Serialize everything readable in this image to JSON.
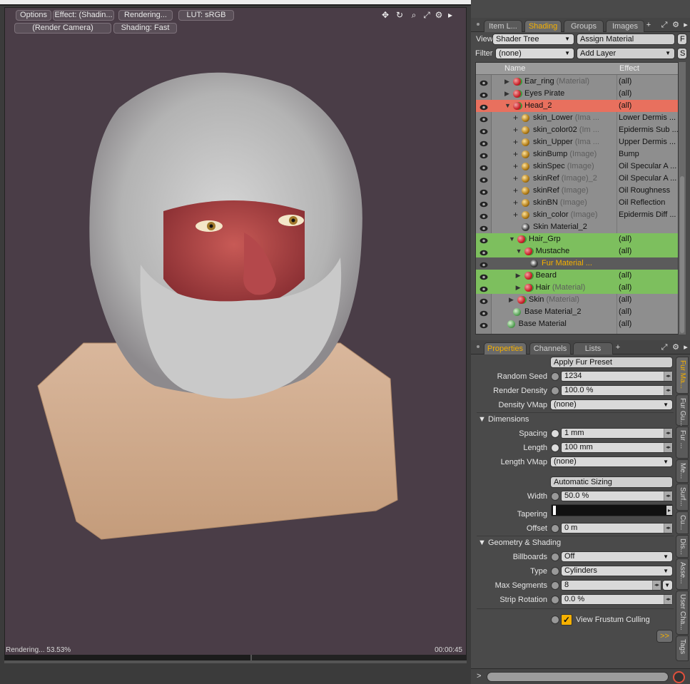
{
  "viewport": {
    "toolbar": {
      "options": "Options",
      "effect": "Effect: (Shadin...",
      "rendering": "Rendering...",
      "lut": "LUT: sRGB",
      "camera": "(Render Camera)",
      "shading": "Shading: Fast"
    },
    "status_left": "Rendering... 53.53%",
    "status_right": "00:00:45",
    "progress": 0.5353
  },
  "shading_panel": {
    "tabs": [
      "Item L...",
      "Shading",
      "Groups",
      "Images"
    ],
    "active_tab": "Shading",
    "add_tab": "+",
    "view_label": "View",
    "view_value": "Shader Tree",
    "assign_material": "Assign Material",
    "f_button": "F",
    "filter_label": "Filter",
    "filter_value": "(none)",
    "add_layer": "Add Layer",
    "s_button": "S",
    "columns": {
      "name": "Name",
      "effect": "Effect"
    },
    "rows": [
      {
        "name": "Ear_ring",
        "type": "(Material)",
        "effect": "(all)",
        "indent": 1,
        "expander": "arrow-right",
        "ball": "red"
      },
      {
        "name": "Eyes Pirate",
        "type": "",
        "effect": "(all)",
        "indent": 1,
        "expander": "arrow-right",
        "ball": "red"
      },
      {
        "name": "Head_2",
        "type": "",
        "effect": "(all)",
        "indent": 1,
        "expander": "arrow-down",
        "ball": "red",
        "highlight": "red"
      },
      {
        "name": "skin_Lower",
        "type": "(Ima ...",
        "effect": "Lower Dermis ...",
        "indent": 2,
        "expander": "plus",
        "ball": "image"
      },
      {
        "name": "skin_color02",
        "type": "(Im ...",
        "effect": "Epidermis Sub ...",
        "indent": 2,
        "expander": "plus",
        "ball": "image"
      },
      {
        "name": "skin_Upper",
        "type": "(Ima ...",
        "effect": "Upper Dermis ...",
        "indent": 2,
        "expander": "plus",
        "ball": "image"
      },
      {
        "name": "skinBump",
        "type": "(Image)",
        "effect": "Bump",
        "indent": 2,
        "expander": "plus",
        "ball": "image"
      },
      {
        "name": "skinSpec",
        "type": "(Image)",
        "effect": "Oil Specular A ...",
        "indent": 2,
        "expander": "plus",
        "ball": "image"
      },
      {
        "name": "skinRef",
        "type": "(Image)_2",
        "effect": "Oil Specular A ...",
        "indent": 2,
        "expander": "plus",
        "ball": "image"
      },
      {
        "name": "skinRef",
        "type": "(Image)",
        "effect": "Oil Roughness",
        "indent": 2,
        "expander": "plus",
        "ball": "image"
      },
      {
        "name": "skinBN",
        "type": "(Image)",
        "effect": "Oil Reflection",
        "indent": 2,
        "expander": "plus",
        "ball": "image"
      },
      {
        "name": "skin_color",
        "type": "(Image)",
        "effect": "Epidermis Diff ...",
        "indent": 2,
        "expander": "plus",
        "ball": "image"
      },
      {
        "name": "Skin Material_2",
        "type": "",
        "effect": "",
        "indent": 2,
        "expander": "none",
        "ball": "fur"
      },
      {
        "name": "Hair_Grp",
        "type": "",
        "effect": "(all)",
        "indent": 1.5,
        "expander": "arrow-down",
        "ball": "red",
        "highlight": "green"
      },
      {
        "name": "Mustache",
        "type": "",
        "effect": "(all)",
        "indent": 2.3,
        "expander": "arrow-down",
        "ball": "red",
        "highlight": "green"
      },
      {
        "name": "Fur Material ...",
        "type": "",
        "effect": "",
        "indent": 3,
        "expander": "none",
        "ball": "fur",
        "highlight": "selected"
      },
      {
        "name": "Beard",
        "type": "",
        "effect": "(all)",
        "indent": 2.3,
        "expander": "arrow-right",
        "ball": "red",
        "highlight": "green"
      },
      {
        "name": "Hair",
        "type": "(Material)",
        "effect": "(all)",
        "indent": 2.3,
        "expander": "arrow-right",
        "ball": "red",
        "highlight": "green"
      },
      {
        "name": "Skin",
        "type": "(Material)",
        "effect": "(all)",
        "indent": 1.5,
        "expander": "arrow-right",
        "ball": "red"
      },
      {
        "name": "Base Material_2",
        "type": "",
        "effect": "(all)",
        "indent": 1,
        "expander": "none",
        "ball": "green"
      },
      {
        "name": "Base Material",
        "type": "",
        "effect": "(all)",
        "indent": 0.3,
        "expander": "none",
        "ball": "green"
      }
    ]
  },
  "properties_panel": {
    "tabs": [
      "Properties",
      "Channels",
      "Lists"
    ],
    "active_tab": "Properties",
    "add_tab": "+",
    "apply_preset": "Apply Fur Preset",
    "random_seed": {
      "label": "Random Seed",
      "value": "1234"
    },
    "render_density": {
      "label": "Render Density",
      "value": "100.0 %"
    },
    "density_vmap": {
      "label": "Density VMap",
      "value": "(none)"
    },
    "dimensions_header": "Dimensions",
    "spacing": {
      "label": "Spacing",
      "value": "1 mm"
    },
    "length": {
      "label": "Length",
      "value": "100 mm"
    },
    "length_vmap": {
      "label": "Length VMap",
      "value": "(none)"
    },
    "auto_sizing": "Automatic Sizing",
    "width": {
      "label": "Width",
      "value": "50.0 %"
    },
    "tapering": {
      "label": "Tapering"
    },
    "offset": {
      "label": "Offset",
      "value": "0 m"
    },
    "geometry_header": "Geometry & Shading",
    "billboards": {
      "label": "Billboards",
      "value": "Off"
    },
    "type": {
      "label": "Type",
      "value": "Cylinders"
    },
    "max_segments": {
      "label": "Max Segments",
      "value": "8"
    },
    "strip_rotation": {
      "label": "Strip Rotation",
      "value": "0.0 %"
    },
    "frustum": {
      "label": "View Frustum Culling",
      "checked": true
    },
    "more_button": ">>",
    "side_tabs": [
      "Fur Ma...",
      "Fur Gu...",
      "Fur ...",
      "Me...",
      "Surf...",
      "Cu...",
      "Dis...",
      "Asse...",
      "User Cha...",
      "Tags"
    ],
    "active_side_tab": "Fur Ma..."
  },
  "command_bar": {
    "prompt": ">"
  },
  "colors": {
    "accent": "#f5b000",
    "tree_bg": "#8e8e8e",
    "highlight_red": "#e8705e",
    "highlight_green": "#7dbf5e",
    "selected_row": "#5b5b5b",
    "viewport_bg": "#4a3d47"
  }
}
